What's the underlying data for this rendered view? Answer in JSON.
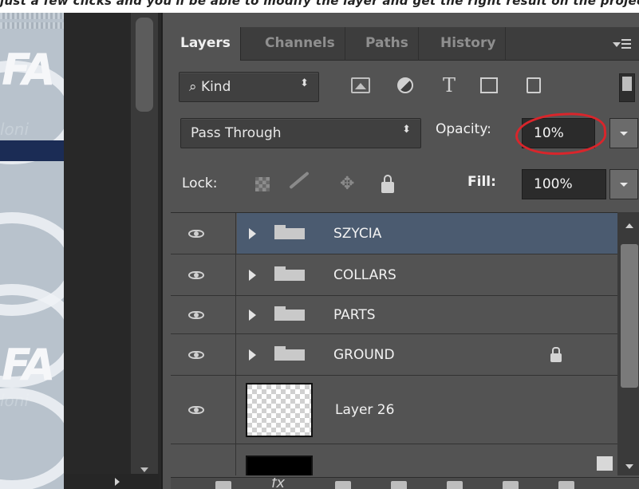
{
  "top_strip": {
    "text": "just a few clicks and you'll be able to modify the layer and get the right result on the project"
  },
  "canvas": {
    "logo_text": "FA",
    "logo_sub": "loni"
  },
  "panel": {
    "tabs": [
      {
        "label": "Layers",
        "active": true
      },
      {
        "label": "Channels",
        "active": false
      },
      {
        "label": "Paths",
        "active": false
      },
      {
        "label": "History",
        "active": false
      }
    ],
    "filter": {
      "search_glyph": "⌕",
      "kind_label": "Kind",
      "caret": "⬍",
      "type_icon_glyph": "T"
    },
    "blend": {
      "mode": "Pass Through",
      "caret": "⬍",
      "opacity_label": "Opacity:",
      "opacity_value": "10%"
    },
    "lock": {
      "label": "Lock:",
      "move_glyph": "✥",
      "fill_label": "Fill:",
      "fill_value": "100%"
    },
    "layers": [
      {
        "name": "SZYCIA",
        "type": "group",
        "selected": true,
        "locked": false
      },
      {
        "name": "COLLARS",
        "type": "group",
        "selected": false,
        "locked": false
      },
      {
        "name": "PARTS",
        "type": "group",
        "selected": false,
        "locked": false
      },
      {
        "name": "GROUND",
        "type": "group",
        "selected": false,
        "locked": true
      },
      {
        "name": "Layer 26",
        "type": "pixel",
        "selected": false,
        "locked": false
      }
    ],
    "bottom_bar": {
      "fx_label": "fx"
    }
  },
  "colors": {
    "panel_bg": "#535353",
    "selected_row": "#4b5b70",
    "annotation_circle": "#d9252b"
  }
}
